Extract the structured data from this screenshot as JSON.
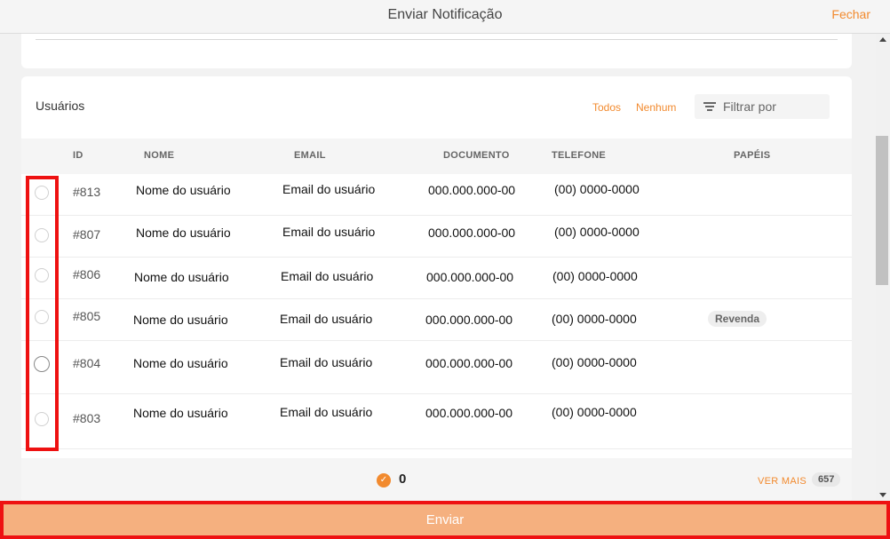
{
  "header": {
    "title": "Enviar Notificação",
    "close_label": "Fechar"
  },
  "users": {
    "title": "Usuários",
    "all_label": "Todos",
    "none_label": "Nenhum",
    "filter_placeholder": "Filtrar por",
    "columns": [
      "ID",
      "NOME",
      "EMAIL",
      "DOCUMENTO",
      "TELEFONE",
      "PAPÉIS"
    ],
    "rows": [
      {
        "id": "#813",
        "name": "Nome do usuário",
        "email": "Email do usuário",
        "document": "000.000.000-00",
        "phone": "(00) 0000-0000",
        "role": ""
      },
      {
        "id": "#807",
        "name": "Nome do usuário",
        "email": "Email do usuário",
        "document": "000.000.000-00",
        "phone": "(00) 0000-0000",
        "role": ""
      },
      {
        "id": "#806",
        "name": "Nome do usuário",
        "email": "Email do usuário",
        "document": "000.000.000-00",
        "phone": "(00) 0000-0000",
        "role": ""
      },
      {
        "id": "#805",
        "name": "Nome do usuário",
        "email": "Email do usuário",
        "document": "000.000.000-00",
        "phone": "(00) 0000-0000",
        "role": "Revenda"
      },
      {
        "id": "#804",
        "name": "Nome do usuário",
        "email": "Email do usuário",
        "document": "000.000.000-00",
        "phone": "(00) 0000-0000",
        "role": ""
      },
      {
        "id": "#803",
        "name": "Nome do usuário",
        "email": "Email do usuário",
        "document": "000.000.000-00",
        "phone": "(00) 0000-0000",
        "role": ""
      }
    ],
    "selected_count": "0",
    "see_more_label": "VER MAIS",
    "total": "657"
  },
  "footer": {
    "send_label": "Enviar"
  },
  "colors": {
    "accent": "#f28a2e",
    "send_button": "#f5b07f",
    "highlight": "#ee1111"
  }
}
